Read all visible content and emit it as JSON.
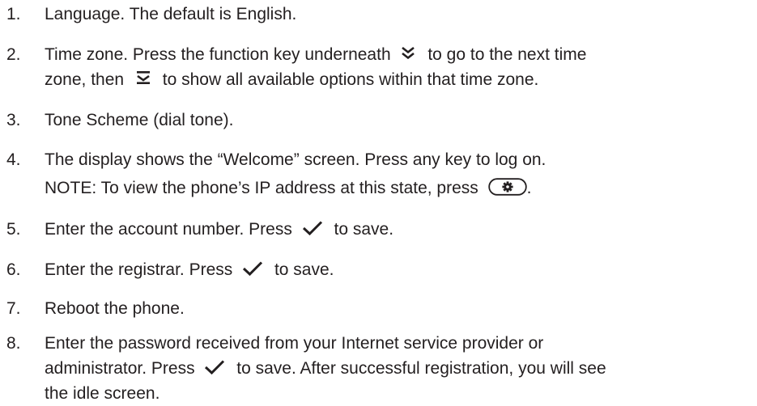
{
  "items": [
    {
      "num": "1.",
      "lines": [
        "Language. The default is English."
      ]
    },
    {
      "num": "2.",
      "parts": {
        "a": "Time zone. Press the function key underneath",
        "b": "to go to the next time",
        "c": "zone, then",
        "d": "to show  all available options within that time zone."
      }
    },
    {
      "num": "3.",
      "lines": [
        "Tone Scheme (dial tone)."
      ]
    },
    {
      "num": "4.",
      "parts": {
        "a": "The display shows the “Welcome” screen. Press any key to log on.",
        "b": "NOTE: To view the phone’s IP address at this state, press",
        "c": "."
      }
    },
    {
      "num": "5.",
      "parts": {
        "a": "Enter the account number. Press",
        "b": "to save."
      }
    },
    {
      "num": "6.",
      "parts": {
        "a": "Enter the registrar. Press",
        "b": "to save."
      }
    },
    {
      "num": "7.",
      "lines": [
        "Reboot the phone."
      ]
    },
    {
      "num": "8.",
      "parts": {
        "a": "Enter the password received from your Internet service provider or",
        "b": "administrator. Press",
        "c": "to save. After successful registration, you will see",
        "d": "the idle screen."
      }
    }
  ],
  "icons": {
    "next": "double-chevron-down-icon",
    "options": "bar-chevron-down-icon",
    "settings": "gear-key-icon",
    "save": "checkmark-icon"
  },
  "colors": {
    "text": "#231f20",
    "background": "#ffffff"
  }
}
